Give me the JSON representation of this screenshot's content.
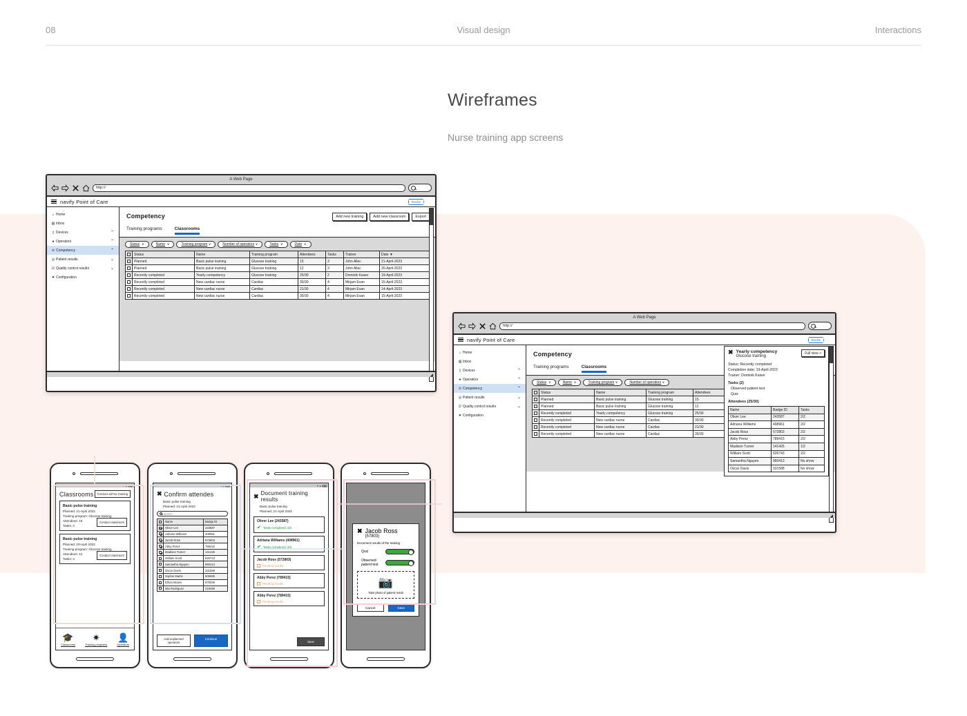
{
  "page_header": {
    "number": "08",
    "center": "Visual design",
    "right": "Interactions"
  },
  "section": {
    "title": "Wireframes",
    "subtitle": "Nurse training app screens"
  },
  "browser": {
    "window_title": "A Web Page",
    "url_value": "http://"
  },
  "app": {
    "brand": "navify Point of Care",
    "logo": "Roche",
    "sidebar": [
      {
        "label": "Home",
        "icon": "home-icon",
        "chevron": ""
      },
      {
        "label": "Inbox",
        "icon": "inbox-icon",
        "chevron": ""
      },
      {
        "label": "Devices",
        "icon": "device-icon",
        "chevron": "up"
      },
      {
        "label": "Operators",
        "icon": "person-icon",
        "chevron": "up"
      },
      {
        "label": "Competency",
        "icon": "trophy-icon",
        "chevron": "up"
      },
      {
        "label": "Patient results",
        "icon": "target-icon",
        "chevron": "down"
      },
      {
        "label": "Quality control results",
        "icon": "check-square-icon",
        "chevron": "down"
      },
      {
        "label": "Configuration",
        "icon": "gear-icon",
        "chevron": ""
      }
    ],
    "page_title": "Competency",
    "buttons": {
      "add_training": "Add new training",
      "add_classroom": "Add new classroom",
      "export": "Export"
    },
    "tabs": [
      {
        "label": "Training programs",
        "selected": false
      },
      {
        "label": "Classrooms",
        "selected": true
      }
    ],
    "filters": [
      "Status",
      "Name",
      "Training program",
      "Number of operators",
      "Tasks",
      "Date"
    ],
    "table": {
      "headers": [
        "",
        "Status",
        "Name",
        "Training program",
        "Attendees",
        "Tasks",
        "Trainer",
        "Date"
      ],
      "sorted_column": "Trainer Date",
      "rows": [
        [
          "Planned",
          "Basic pulse training",
          "Glucose training",
          "15",
          "3",
          "John Allec",
          "21-April-2023"
        ],
        [
          "Planned",
          "Basic pulse training",
          "Glucose training",
          "12",
          "3",
          "John Allec",
          "20-April-2023"
        ],
        [
          "Recently completed",
          "Yearly competency",
          "Glucose training",
          "25/30",
          "2",
          "Dominik Kaiser",
          "19-April-2023"
        ],
        [
          "Recently completed",
          "New cardiac nurse",
          "Cardiac",
          "30/30",
          "4",
          "Mirjam Evan",
          "15-April-2023"
        ],
        [
          "Recently completed",
          "New cardiac nurse",
          "Cardiac",
          "21/30",
          "4",
          "Mirjam Evan",
          "14-April-2023"
        ],
        [
          "Recently completed",
          "New cardiac nurse",
          "Cardiac",
          "30/30",
          "4",
          "Mirjam Evan",
          "15-April-2023"
        ]
      ]
    }
  },
  "detail_panel": {
    "title": "Yearly competency",
    "subtitle": "Glucose training",
    "full_view": "Full view >",
    "status": "Status: Recently completed",
    "completion": "Completion date: 19-April-2023",
    "trainer": "Trainer: Dominik Kaiser",
    "tasks_heading": "Tasks (2)",
    "tasks": [
      "Observed patient test",
      "Quiz"
    ],
    "attendees_heading": "Attendees (25/30)",
    "attendee_headers": [
      "Name",
      "Badge ID",
      "Tasks"
    ],
    "attendees": [
      [
        "Oliver Lee",
        "243587",
        "2/2"
      ],
      [
        "Adriana Williams",
        "408961",
        "2/2"
      ],
      [
        "Jacob Ross",
        "572803",
        "2/2"
      ],
      [
        "Abby Perez",
        "789415",
        "2/2"
      ],
      [
        "Madison Turner",
        "141426",
        "1/2"
      ],
      [
        "William Scott",
        "626743",
        "2/2"
      ],
      [
        "Samantha Nguyen",
        "960413",
        "No show"
      ],
      [
        "Oscar Davis",
        "331588",
        "No show"
      ]
    ]
  },
  "phone1": {
    "title": "Classrooms",
    "adhoc_button": "Conduct ad-hoc training",
    "cards": [
      {
        "name": "Basic pulse training",
        "planned": "Planned: 21-April 2023",
        "program": "Training program: Glucose training",
        "attendees": "Attendees: 15",
        "tasks": "Tasks: 3",
        "button": "Conduct classroom"
      },
      {
        "name": "Basic pulse training",
        "planned": "Planned: 20-April 2023",
        "program": "Training program: Glucose training",
        "attendees": "Attendees: 12",
        "tasks": "Tasks: 3",
        "button": "Conduct classroom"
      }
    ],
    "tabbar": [
      {
        "label": "Classrooms",
        "icon": "graduation-cap-icon"
      },
      {
        "label": "Training programs",
        "icon": "gear-icon"
      },
      {
        "label": "Operators",
        "icon": "person-icon"
      }
    ]
  },
  "phone2": {
    "title": "Confirm attendes",
    "sub1": "Basic pulse training",
    "sub2": "Planned: 21-April 2023",
    "search_placeholder": "search",
    "headers": [
      "Name",
      "Badge ID"
    ],
    "rows": [
      {
        "name": "Oliver Lee",
        "badge": "243587",
        "checked": true
      },
      {
        "name": "Adriana Williams",
        "badge": "408961",
        "checked": true
      },
      {
        "name": "Jacob Ross",
        "badge": "572803",
        "checked": true
      },
      {
        "name": "Abby Perez",
        "badge": "789415",
        "checked": true
      },
      {
        "name": "Madison Turner",
        "badge": "141426",
        "checked": true
      },
      {
        "name": "William Scott",
        "badge": "626743",
        "checked": false
      },
      {
        "name": "Samantha Nguyen",
        "badge": "960413",
        "checked": false
      },
      {
        "name": "Oscar Davis",
        "badge": "331588",
        "checked": false
      },
      {
        "name": "Sophie Martin",
        "badge": "505685",
        "checked": false
      },
      {
        "name": "Ethan Brown",
        "badge": "876039",
        "checked": false
      },
      {
        "name": "Mia Rodriguez",
        "badge": "219498",
        "checked": false
      }
    ],
    "add_button": "Add unplanned operators",
    "continue_button": "Continue"
  },
  "phone3": {
    "title": "Document training results",
    "sub1": "Basic pulse training",
    "sub2": "Planned: 21-April 2023",
    "results": [
      {
        "name": "Oliver Lee (243587)",
        "status": "Tasks completed: 2/2",
        "state": "done"
      },
      {
        "name": "Adriana Williams (408961)",
        "status": "Tasks completed: 2/2",
        "state": "done"
      },
      {
        "name": "Jacob Ross (572803)",
        "status": "Pending results",
        "state": "pending"
      },
      {
        "name": "Abby Perez (789415)",
        "status": "Pending results",
        "state": "pending"
      },
      {
        "name": "Abby Perez (789415)",
        "status": "Pending results",
        "state": "pending"
      }
    ],
    "save_button": "Save"
  },
  "phone4": {
    "name": "Jacob Ross",
    "id": "(57803)",
    "subtitle": "Document results of the training",
    "toggles": [
      {
        "label": "Quiz",
        "on": true
      },
      {
        "label": "Observed patient test",
        "on": true
      }
    ],
    "photo_caption": "Take photo of patient result",
    "cancel_button": "Cancel",
    "save_button": "Save"
  },
  "colors": {
    "accent_blue": "#1767c4",
    "highlight_blue": "#cfe0f5",
    "pink_bg": "#fdf2ee",
    "green": "#11a02a",
    "orange": "#e8a06a"
  }
}
